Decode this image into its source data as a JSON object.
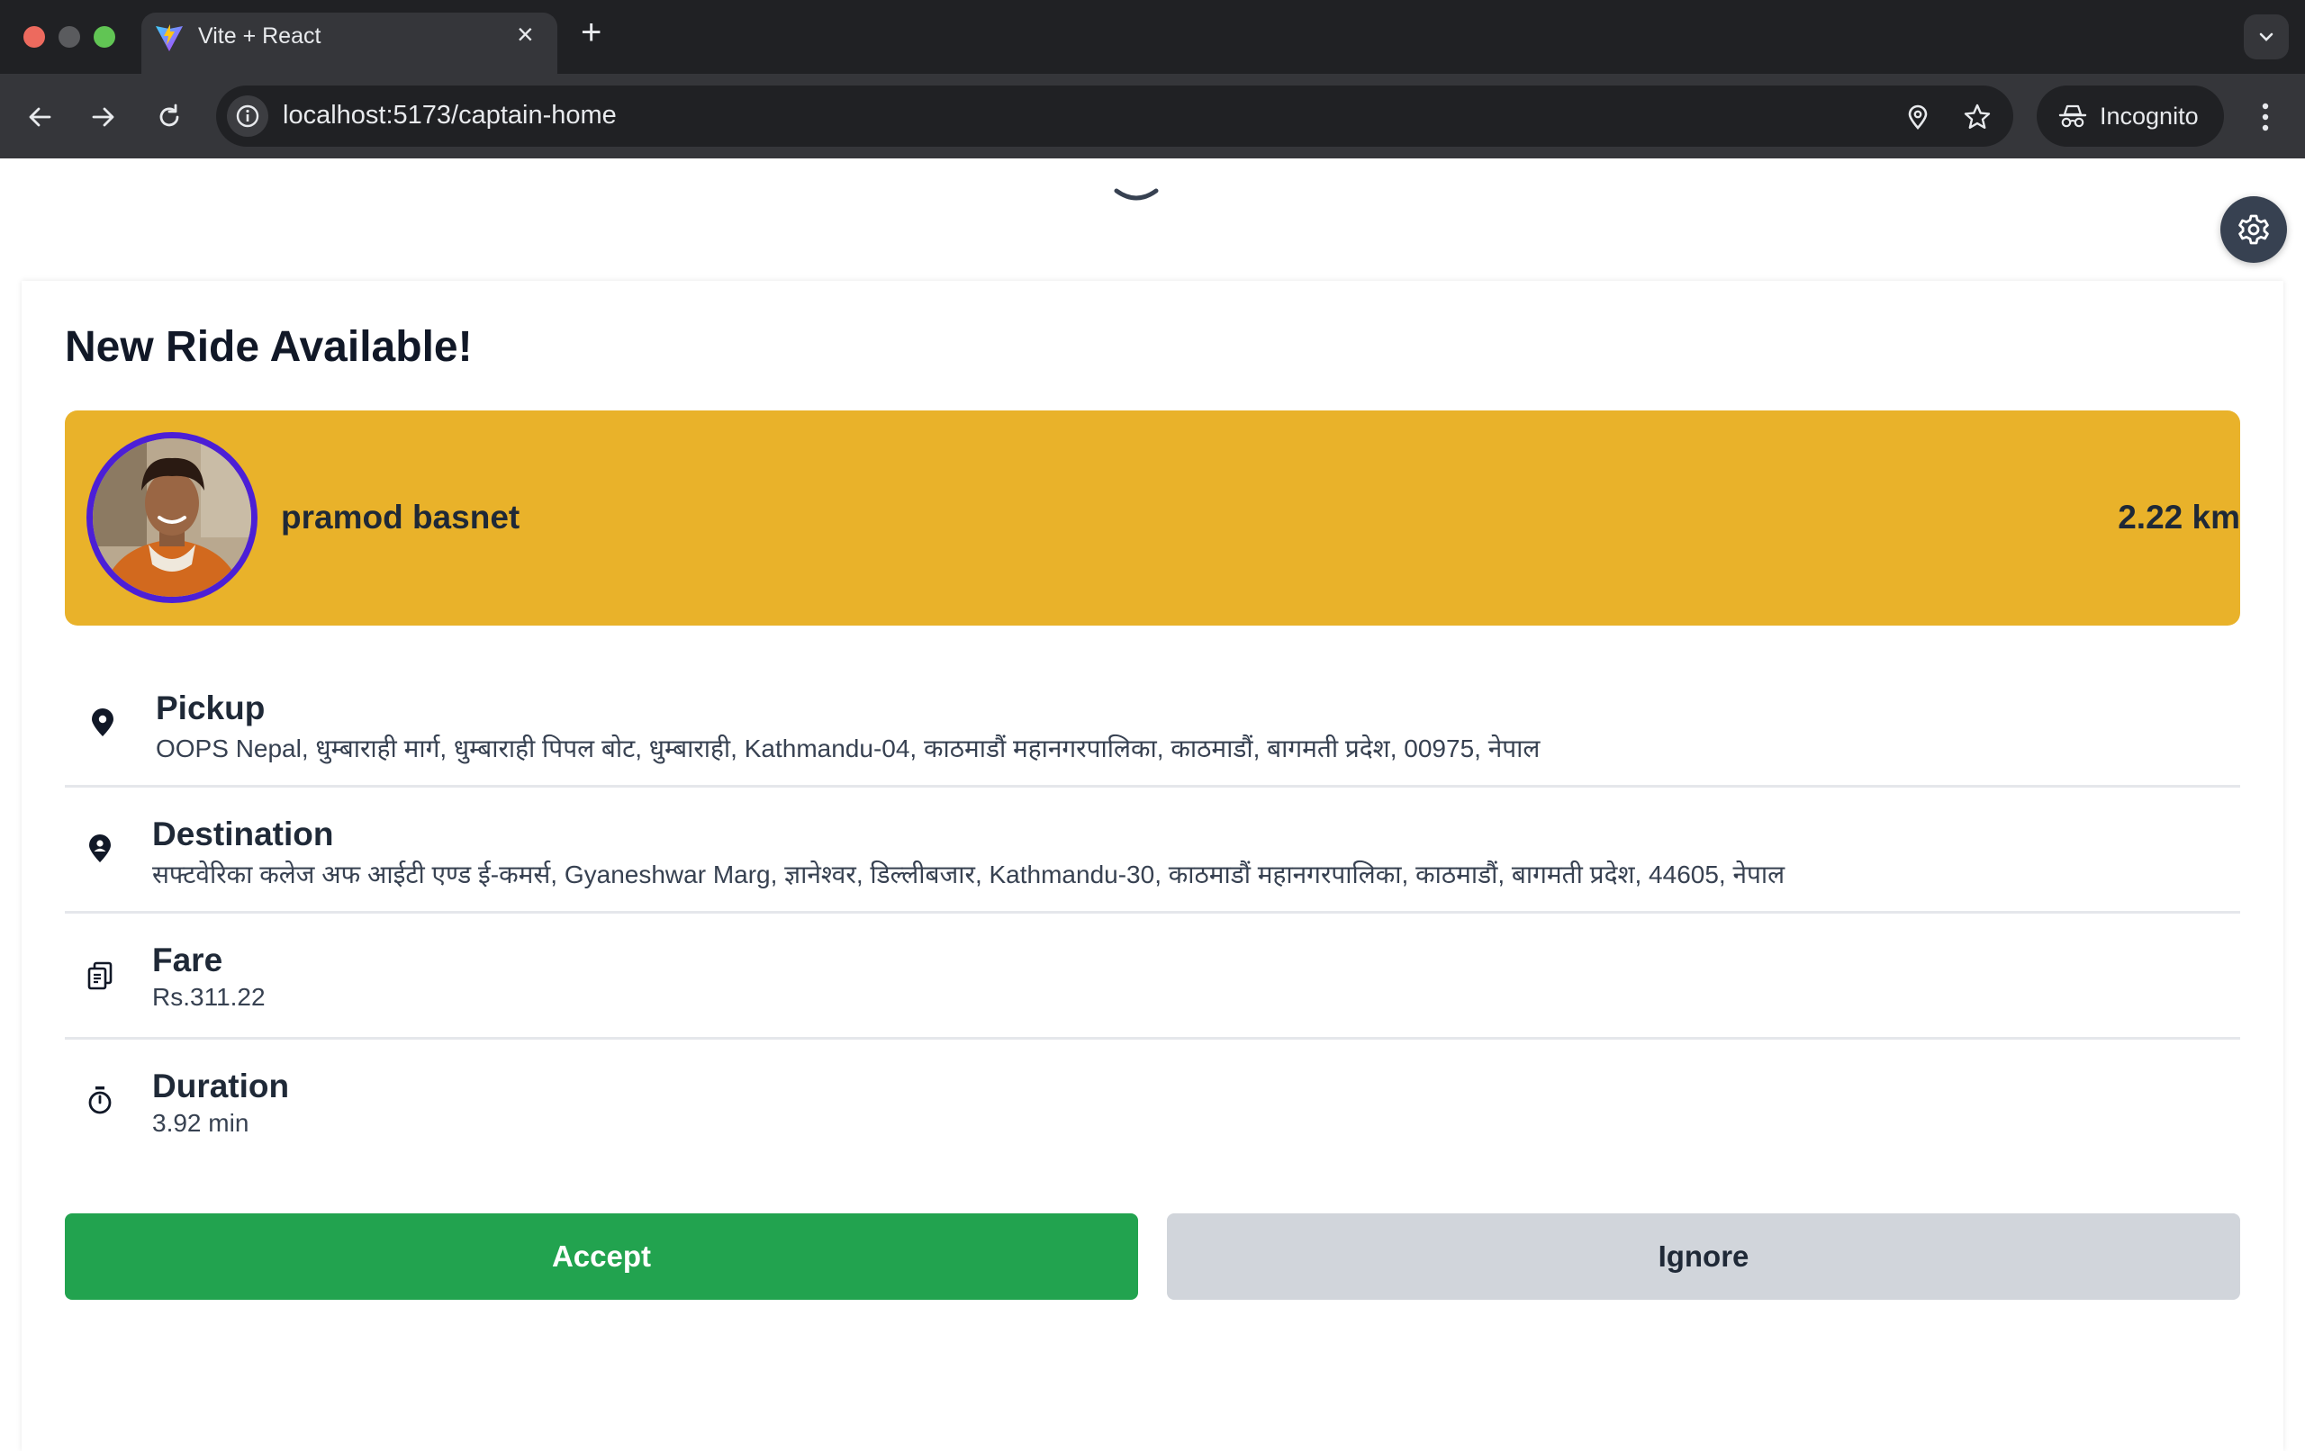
{
  "browser": {
    "tab_title": "Vite + React",
    "url": "localhost:5173/captain-home",
    "incognito_label": "Incognito"
  },
  "colors": {
    "rider_card_bg": "#e9b22a",
    "accept_bg": "#22a34f",
    "ignore_bg": "#d1d5db",
    "avatar_border": "#4c1fd6"
  },
  "ride": {
    "heading": "New Ride Available!",
    "rider_name": "pramod basnet",
    "distance": "2.22 km",
    "details": [
      {
        "icon": "map-pin-icon",
        "label": "Pickup",
        "value": "OOPS Nepal, धुम्बाराही मार्ग, धुम्बाराही पिपल बोट, धुम्बाराही, Kathmandu-04, काठमाडौं महानगरपालिका, काठमाडौं, बागमती प्रदेश, 00975, नेपाल"
      },
      {
        "icon": "user-location-icon",
        "label": "Destination",
        "value": "सफ्टवेरिका कलेज अफ आईटी एण्ड ई-कमर्स, Gyaneshwar Marg, ज्ञानेश्वर, डिल्लीबजार, Kathmandu-30, काठमाडौं महानगरपालिका, काठमाडौं, बागमती प्रदेश, 44605, नेपाल"
      },
      {
        "icon": "bill-icon",
        "label": "Fare",
        "value": "Rs.311.22"
      },
      {
        "icon": "timer-icon",
        "label": "Duration",
        "value": "3.92 min"
      }
    ],
    "accept_label": "Accept",
    "ignore_label": "Ignore"
  }
}
